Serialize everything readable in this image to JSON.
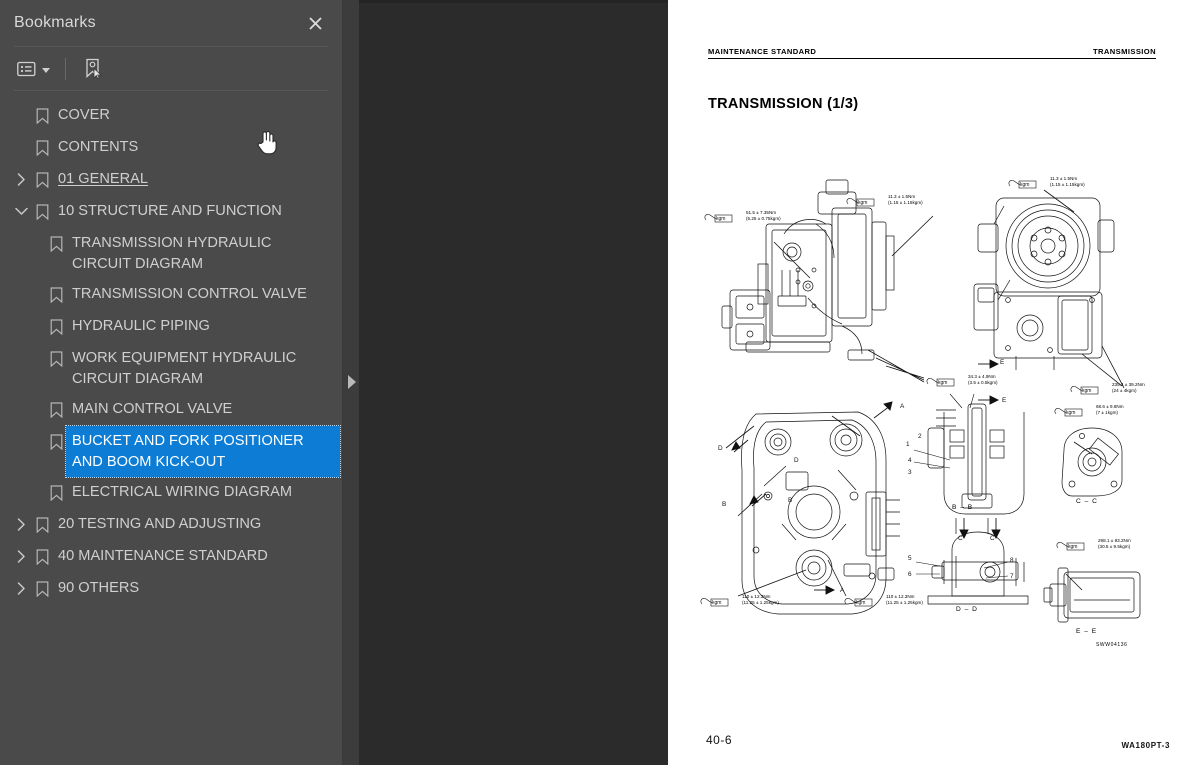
{
  "panel": {
    "title": "Bookmarks",
    "close_icon": "close-icon",
    "toolbar": {
      "options_icon": "list-options-icon",
      "caret_icon": "chevron-down-icon",
      "new_bookmark_icon": "bookmark-cursor-icon"
    }
  },
  "bookmarks": [
    {
      "label": "COVER",
      "level": 0,
      "twisty": "none",
      "state": "normal"
    },
    {
      "label": "CONTENTS",
      "level": 0,
      "twisty": "none",
      "state": "normal"
    },
    {
      "label": "01 GENERAL",
      "level": 0,
      "twisty": "right",
      "state": "underline"
    },
    {
      "label": "10 STRUCTURE AND FUNCTION",
      "level": 0,
      "twisty": "down",
      "state": "normal"
    },
    {
      "label": "TRANSMISSION HYDRAULIC CIRCUIT DIAGRAM",
      "level": 1,
      "twisty": "none",
      "state": "normal"
    },
    {
      "label": "TRANSMISSION CONTROL VALVE",
      "level": 1,
      "twisty": "none",
      "state": "normal"
    },
    {
      "label": "HYDRAULIC PIPING",
      "level": 1,
      "twisty": "none",
      "state": "normal"
    },
    {
      "label": "WORK EQUIPMENT HYDRAULIC CIRCUIT DIAGRAM",
      "level": 1,
      "twisty": "none",
      "state": "normal"
    },
    {
      "label": "MAIN CONTROL VALVE",
      "level": 1,
      "twisty": "none",
      "state": "normal"
    },
    {
      "label": "BUCKET AND FORK POSITIONER AND BOOM KICK-OUT",
      "level": 1,
      "twisty": "none",
      "state": "selected"
    },
    {
      "label": "ELECTRICAL WIRING DIAGRAM",
      "level": 1,
      "twisty": "none",
      "state": "normal"
    },
    {
      "label": "20 TESTING AND ADJUSTING",
      "level": 0,
      "twisty": "right",
      "state": "normal"
    },
    {
      "label": "40 MAINTENANCE STANDARD",
      "level": 0,
      "twisty": "right",
      "state": "normal"
    },
    {
      "label": "90 OTHERS",
      "level": 0,
      "twisty": "right",
      "state": "normal"
    }
  ],
  "splitter": {
    "collapse_icon": "collapse-panel-arrow-icon"
  },
  "cursor": {
    "icon": "hand-pointer-cursor"
  },
  "document": {
    "header_left": "MAINTENANCE STANDARD",
    "header_right": "TRANSMISSION",
    "title": "TRANSMISSION (1/3)",
    "footer_left": "40-6",
    "footer_right": "WA180PT-3",
    "drawing_number": "SWW04136",
    "callouts": [
      {
        "line1": "51.5 ± 7.35Nm",
        "line2": "(5.25 ± 0.75kgm)"
      },
      {
        "line1": "11.3 ± 1.5Nm",
        "line2": "(1.15 ± 1.15kgm)"
      },
      {
        "line1": "11.3 ± 1.5Nm",
        "line2": "(1.15 ± 1.15kgm)"
      },
      {
        "line1": "34.3 ± 4.9Nm",
        "line2": "(3.5 ± 0.5kgm)"
      },
      {
        "line1": "235.4 ± 39.2Nm",
        "line2": "(24 ± 4kgm)"
      },
      {
        "line1": "68.6 ± 9.8Nm",
        "line2": "(7 ± 1kgm)"
      },
      {
        "line1": "298.1 ± 93.2Nm",
        "line2": "(30.5 ± 9.5kgm)"
      },
      {
        "line1": "110 ± 12.3Nm",
        "line2": "(11.25 ± 1.25kgm)"
      },
      {
        "line1": "110 ± 12.3Nm",
        "line2": "(11.25 ± 1.25kgm)"
      }
    ],
    "section_marks": [
      "A",
      "B",
      "C",
      "D",
      "E",
      "C – C",
      "B – B",
      "D – D",
      "E – E"
    ]
  },
  "colors": {
    "panel_bg": "#4a4a4a",
    "viewer_bg": "#2b2b2b",
    "selection_blue": "#0c7cd5",
    "text": "#cfcfcf",
    "page_bg": "#ffffff"
  }
}
